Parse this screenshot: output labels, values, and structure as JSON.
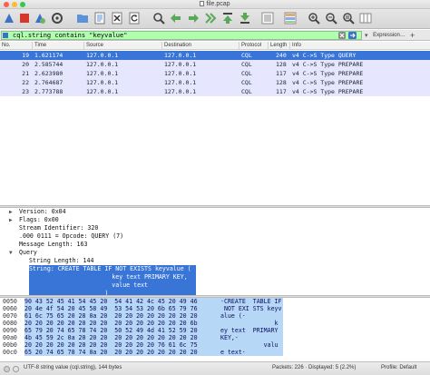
{
  "window": {
    "title": "file.pcap",
    "traffic_colors": [
      "#fc5f57",
      "#fdbc2e",
      "#34c84a"
    ]
  },
  "toolbar": {
    "icons": [
      "shark-fin-start-icon",
      "stop-icon",
      "shark-fin-restart-icon",
      "options-gear-icon",
      "open-folder-icon",
      "save-file-icon",
      "close-file-icon",
      "reload-icon",
      "find-magnifier-icon",
      "go-back-icon",
      "go-forward-icon",
      "go-to-packet-icon",
      "first-packet-icon",
      "last-packet-icon",
      "autoscroll-icon",
      "colorize-icon",
      "zoom-in-icon",
      "zoom-out-icon",
      "normal-size-icon",
      "resize-columns-icon"
    ]
  },
  "filter": {
    "value": "cql.string contains \"keyvalue\"",
    "expression_label": "Expression…",
    "plus_label": "+",
    "dropdown_glyph": "▾",
    "clear_glyph": "✕",
    "apply_glyph": "→",
    "background": "#afffaf"
  },
  "packet_list": {
    "columns": [
      "No.",
      "Time",
      "Source",
      "Destination",
      "Protocol",
      "Length",
      "Info"
    ],
    "rows": [
      {
        "no": "19",
        "time": "1.621174",
        "source": "127.0.0.1",
        "destination": "127.0.0.1",
        "protocol": "CQL",
        "length": "240",
        "info": "v4 C->S Type QUERY",
        "selected": true
      },
      {
        "no": "20",
        "time": "2.585744",
        "source": "127.0.0.1",
        "destination": "127.0.0.1",
        "protocol": "CQL",
        "length": "128",
        "info": "v4 C->S Type PREPARE",
        "selected": false
      },
      {
        "no": "21",
        "time": "2.623980",
        "source": "127.0.0.1",
        "destination": "127.0.0.1",
        "protocol": "CQL",
        "length": "117",
        "info": "v4 C->S Type PREPARE",
        "selected": false
      },
      {
        "no": "22",
        "time": "2.764687",
        "source": "127.0.0.1",
        "destination": "127.0.0.1",
        "protocol": "CQL",
        "length": "128",
        "info": "v4 C->S Type PREPARE",
        "selected": false
      },
      {
        "no": "23",
        "time": "2.773788",
        "source": "127.0.0.1",
        "destination": "127.0.0.1",
        "protocol": "CQL",
        "length": "117",
        "info": "v4 C->S Type PREPARE",
        "selected": false
      }
    ],
    "row_color": "#e7e6ff",
    "selected_color": "#3875d7"
  },
  "details": {
    "lines": [
      {
        "indent": 1,
        "arrow": "▶",
        "text": "Version: 0x04"
      },
      {
        "indent": 1,
        "arrow": "▶",
        "text": "Flags: 0x00"
      },
      {
        "indent": 1,
        "arrow": "",
        "text": "Stream Identifier: 320"
      },
      {
        "indent": 1,
        "arrow": "",
        "text": ".000 0111 = Opcode: QUERY (7)"
      },
      {
        "indent": 1,
        "arrow": "",
        "text": "Message Length: 163"
      },
      {
        "indent": 1,
        "arrow": "▼",
        "text": "Query"
      },
      {
        "indent": 2,
        "arrow": "",
        "text": "String Length: 144"
      },
      {
        "indent": 2,
        "arrow": "",
        "text": "String: CREATE TABLE IF NOT EXISTS keyvalue ("
      },
      {
        "indent": 2,
        "arrow": "",
        "text": "                       key text PRIMARY KEY,"
      },
      {
        "indent": 2,
        "arrow": "",
        "text": "                       value text"
      },
      {
        "indent": 2,
        "arrow": "",
        "text": "                     )"
      }
    ]
  },
  "bytes": {
    "rows": [
      {
        "offset": "0050",
        "hex": "90 43 52 45 41 54 45 20  54 41 42 4c 45 20 49 46",
        "ascii": "·CREATE  TABLE IF"
      },
      {
        "offset": "0060",
        "hex": "20 4e 4f 54 20 45 58 49  53 54 53 20 6b 65 79 76",
        "ascii": " NOT EXI STS keyv"
      },
      {
        "offset": "0070",
        "hex": "61 6c 75 65 20 28 0a 20  20 20 20 20 20 20 20 20",
        "ascii": "alue (·"
      },
      {
        "offset": "0080",
        "hex": "20 20 20 20 20 20 20 20  20 20 20 20 20 20 20 6b",
        "ascii": "               k"
      },
      {
        "offset": "0090",
        "hex": "65 79 20 74 65 78 74 20  50 52 49 4d 41 52 59 20",
        "ascii": "ey text  PRIMARY"
      },
      {
        "offset": "00a0",
        "hex": "4b 45 59 2c 0a 20 20 20  20 20 20 20 20 20 20 20",
        "ascii": "KEY,·"
      },
      {
        "offset": "00b0",
        "hex": "20 20 20 20 20 20 20 20  20 20 20 20 76 61 6c 75",
        "ascii": "            valu"
      },
      {
        "offset": "00c0",
        "hex": "65 20 74 65 78 74 0a 20  20 20 20 20 20 20 20 20",
        "ascii": "e text·"
      }
    ],
    "selection_color": "#b7d7f7"
  },
  "status": {
    "field_text": "UTF-8 string value (cql.string), 144 bytes",
    "packets_text": "Packets: 226 · Displayed: 5 (2.2%)",
    "profile_text": "Profile: Default"
  }
}
